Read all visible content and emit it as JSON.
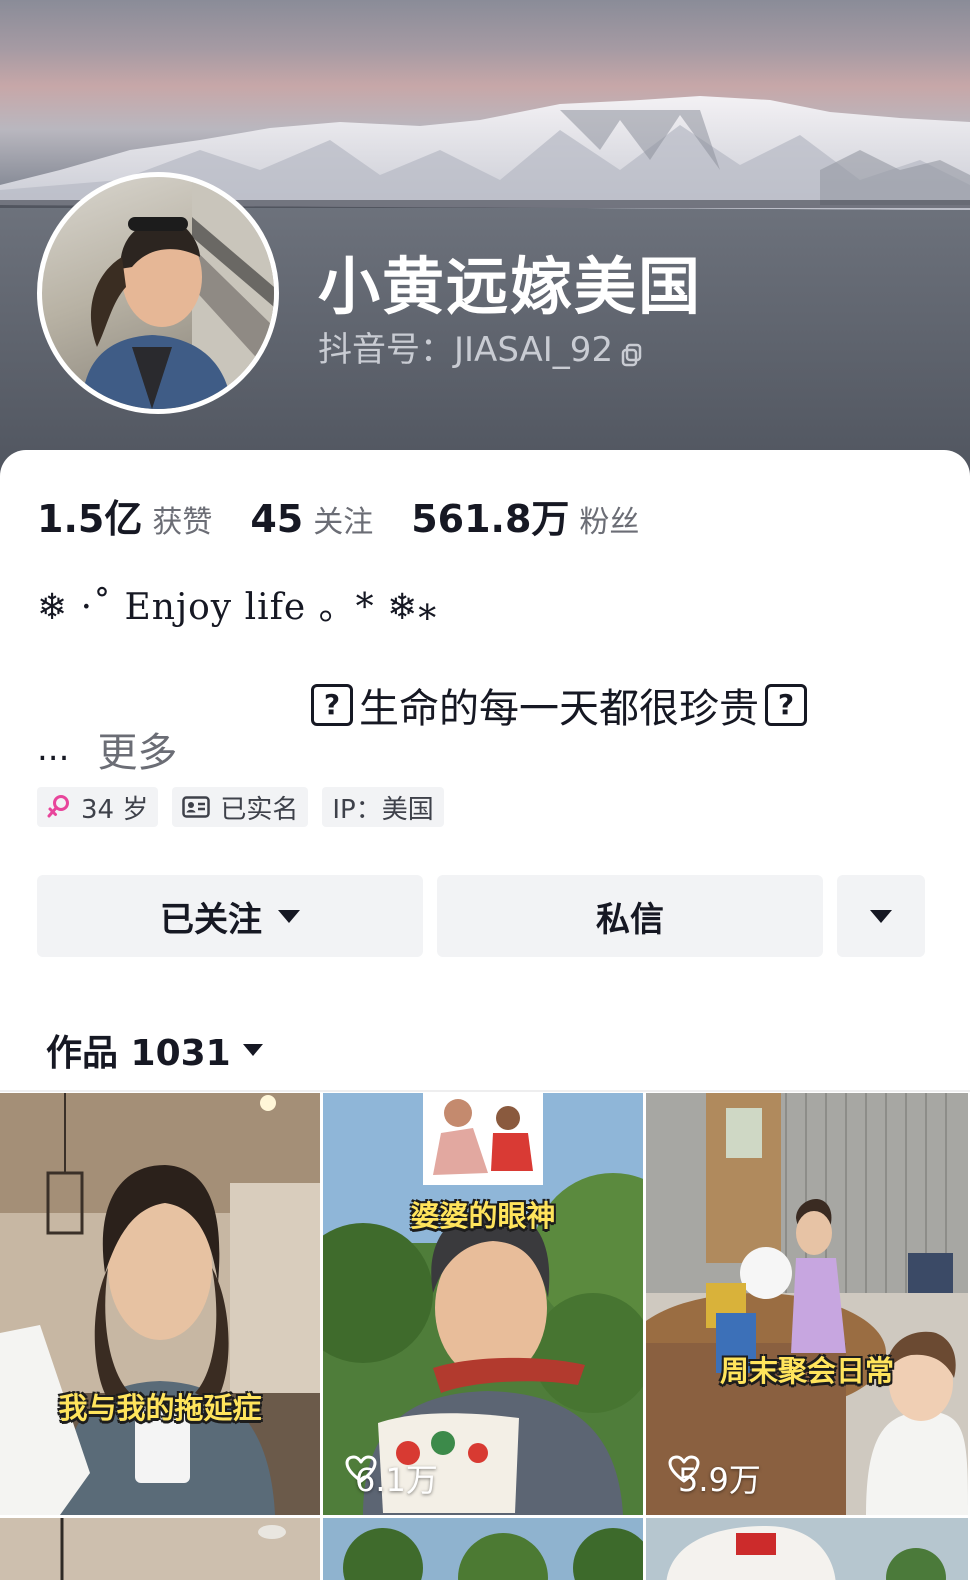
{
  "profile": {
    "name": "小黄远嫁美国",
    "douyin_id": "抖音号：JIASAI_92"
  },
  "stats": [
    {
      "value": "1.5亿",
      "label": "获赞"
    },
    {
      "value": "45",
      "label": "关注"
    },
    {
      "value": "561.8万",
      "label": "粉丝"
    }
  ],
  "bio": {
    "line1": "❄ ·˚ Enjoy life 。* ❄⁎",
    "line2_box": "?",
    "line2_text": "生命的每一天都很珍贵",
    "more_dots": "...",
    "more": "更多"
  },
  "tags": {
    "age": "34 岁",
    "verified": "已实名",
    "ip": "IP：美国"
  },
  "actions": {
    "follow": "已关注",
    "message": "私信"
  },
  "works_tab": {
    "label": "作品 1031"
  },
  "videos": [
    {
      "caption": "我与我的拖延症",
      "likes": ""
    },
    {
      "caption": "婆婆的眼神",
      "likes": "6.1万"
    },
    {
      "caption": "周末聚会日常",
      "likes": "5.9万"
    }
  ],
  "colors": {
    "accent_text": "#161823",
    "muted_text": "#6b6d75",
    "button_bg": "#f2f3f5",
    "caption_yellow": "#ffe45c",
    "gender_pink": "#e8459b"
  },
  "icons": {
    "gender": "female-icon",
    "verified": "id-card-icon",
    "copy": "copy-icon",
    "likes": "heart-icon",
    "dropdown": "caret-down-icon"
  }
}
